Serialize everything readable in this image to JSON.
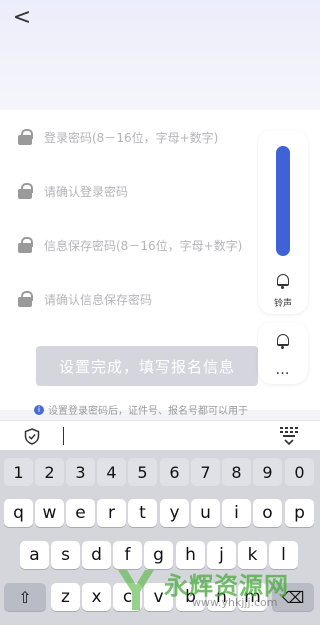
{
  "header": {
    "back_glyph": "<"
  },
  "form": {
    "fields": [
      {
        "placeholder": "登录密码(8－16位，字母+数字)"
      },
      {
        "placeholder": "请确认登录密码"
      },
      {
        "placeholder": "信息保存密码(8－16位，字母+数字)"
      },
      {
        "placeholder": "请确认信息保存密码"
      }
    ],
    "submit_label": "设置完成，填写报名信息",
    "tip": "设置登录密码后，证件号、报名号都可以用于"
  },
  "volume_panel": {
    "ringtone_label": "铃声",
    "more_glyph": "…",
    "volume_level": 1.0,
    "accent_color": "#3f63d6"
  },
  "keyboard": {
    "number_row": [
      "1",
      "2",
      "3",
      "4",
      "5",
      "6",
      "7",
      "8",
      "9",
      "0"
    ],
    "row1": [
      "q",
      "w",
      "e",
      "r",
      "t",
      "y",
      "u",
      "i",
      "o",
      "p"
    ],
    "row2": [
      "a",
      "s",
      "d",
      "f",
      "g",
      "h",
      "j",
      "k",
      "l"
    ],
    "row3": [
      "z",
      "x",
      "c",
      "v",
      "b",
      "n",
      "m"
    ],
    "shift_glyph": "⇧",
    "delete_glyph": "⌫"
  },
  "watermark": {
    "text": "永辉资源网",
    "url": "www.yhkjjj.com"
  }
}
